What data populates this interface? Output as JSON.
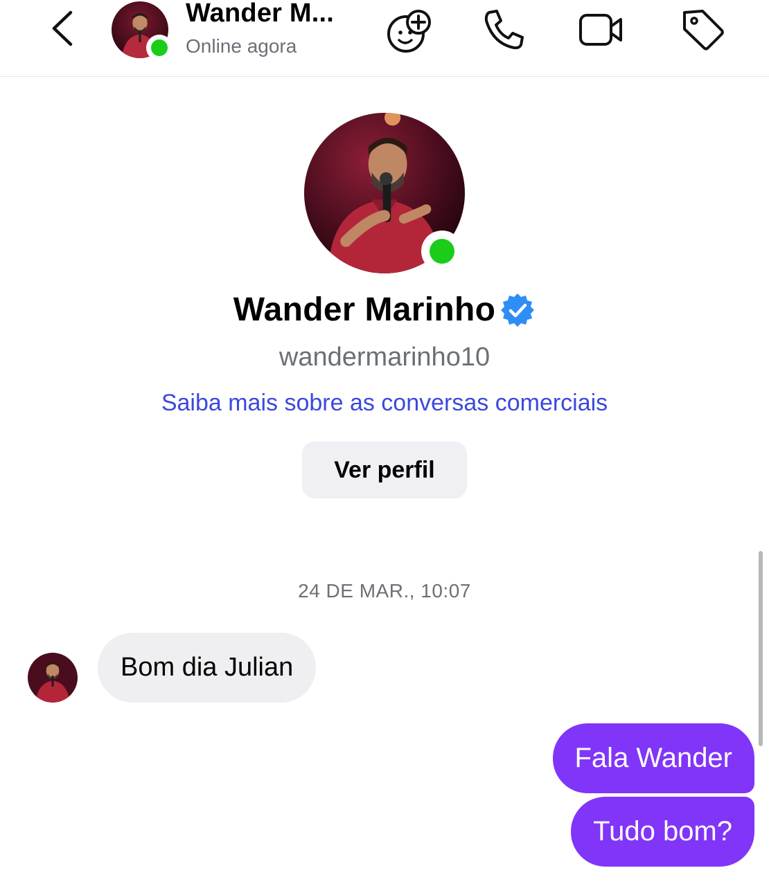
{
  "header": {
    "contact_name": "Wander M...",
    "status": "Online agora",
    "icons": [
      "back-chevron-icon",
      "add-effect-icon",
      "phone-icon",
      "video-camera-icon",
      "tag-icon"
    ]
  },
  "profile": {
    "name": "Wander Marinho",
    "verified": true,
    "username": "wandermarinho10",
    "learn_more_link": "Saiba mais sobre as conversas comerciais",
    "view_profile_label": "Ver perfil"
  },
  "conversation": {
    "timestamp": "24 DE MAR., 10:07",
    "messages": [
      {
        "direction": "incoming",
        "text": "Bom dia Julian"
      },
      {
        "direction": "outgoing",
        "text": "Fala Wander"
      },
      {
        "direction": "outgoing",
        "text": "Tudo bom?"
      }
    ]
  },
  "colors": {
    "outgoing_bubble": "#8135f8",
    "incoming_bubble": "#efeff2",
    "online_dot": "#1bcc1b",
    "link": "#3b48dd",
    "verified_badge": "#2f8ef5"
  }
}
